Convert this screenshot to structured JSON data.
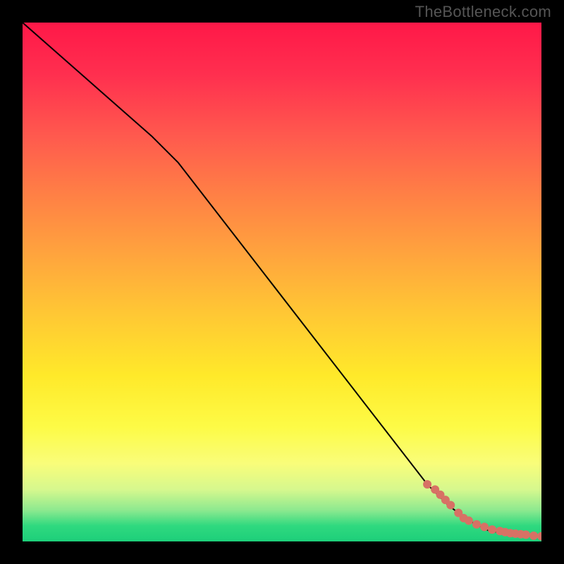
{
  "watermark": "TheBottleneck.com",
  "chart_data": {
    "type": "line",
    "title": "",
    "xlabel": "",
    "ylabel": "",
    "xlim": [
      0,
      100
    ],
    "ylim": [
      0,
      100
    ],
    "grid": false,
    "series": [
      {
        "name": "curve",
        "style": "black-line",
        "x": [
          0,
          25,
          30,
          78,
          82,
          86,
          90,
          94,
          98,
          100
        ],
        "y": [
          100,
          78,
          73,
          11,
          7,
          4,
          2,
          1.5,
          1,
          1
        ]
      },
      {
        "name": "markers",
        "style": "salmon-dots",
        "x": [
          78,
          79.5,
          80.5,
          81.5,
          82.5,
          84,
          85,
          86,
          87.5,
          89,
          90.5,
          92,
          93,
          94,
          95,
          96,
          97,
          98.5,
          100
        ],
        "y": [
          11,
          10,
          9,
          8,
          7,
          5.5,
          4.5,
          4,
          3.3,
          2.8,
          2.3,
          2,
          1.8,
          1.6,
          1.5,
          1.4,
          1.3,
          1.1,
          1
        ]
      }
    ],
    "background": {
      "type": "vertical-gradient",
      "stops": [
        {
          "pos": 0.0,
          "color": "#ff1848"
        },
        {
          "pos": 0.1,
          "color": "#ff2f4f"
        },
        {
          "pos": 0.22,
          "color": "#ff5a4e"
        },
        {
          "pos": 0.32,
          "color": "#ff7c46"
        },
        {
          "pos": 0.44,
          "color": "#ffa23e"
        },
        {
          "pos": 0.56,
          "color": "#ffc734"
        },
        {
          "pos": 0.68,
          "color": "#ffe92a"
        },
        {
          "pos": 0.78,
          "color": "#fdfb46"
        },
        {
          "pos": 0.85,
          "color": "#f9fd7a"
        },
        {
          "pos": 0.9,
          "color": "#d6f88e"
        },
        {
          "pos": 0.94,
          "color": "#8ce98f"
        },
        {
          "pos": 0.97,
          "color": "#2fd97f"
        },
        {
          "pos": 1.0,
          "color": "#1dcf7a"
        }
      ]
    },
    "colors": {
      "line": "#000000",
      "markers": "#d77165"
    }
  }
}
